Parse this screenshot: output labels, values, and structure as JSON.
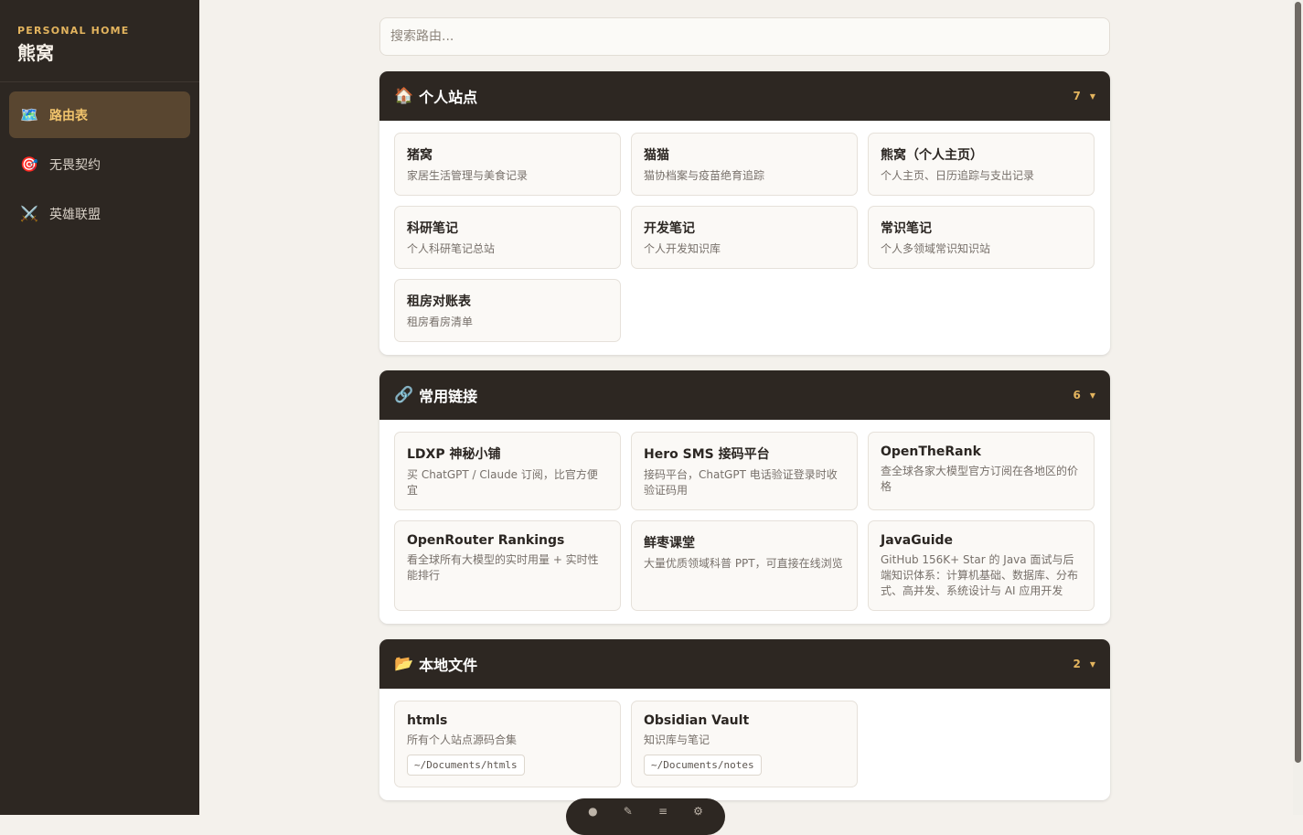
{
  "sidebar": {
    "brand_sub": "PERSONAL HOME",
    "brand_title": "熊窝",
    "items": [
      {
        "icon": "🗺️",
        "label": "路由表",
        "active": true
      },
      {
        "icon": "🎯",
        "label": "无畏契约"
      },
      {
        "icon": "⚔️",
        "label": "英雄联盟"
      }
    ]
  },
  "search": {
    "placeholder": "搜索路由..."
  },
  "sections": [
    {
      "icon": "🏠",
      "title": "个人站点",
      "count": "7",
      "caret": "▼",
      "cards": [
        {
          "title": "猪窝",
          "desc": "家居生活管理与美食记录"
        },
        {
          "title": "猫猫",
          "desc": "猫协档案与疫苗绝育追踪"
        },
        {
          "title": "熊窝（个人主页）",
          "desc": "个人主页、日历追踪与支出记录"
        },
        {
          "title": "科研笔记",
          "desc": "个人科研笔记总站"
        },
        {
          "title": "开发笔记",
          "desc": "个人开发知识库"
        },
        {
          "title": "常识笔记",
          "desc": "个人多领域常识知识站"
        },
        {
          "title": "租房对账表",
          "desc": "租房看房清单"
        }
      ]
    },
    {
      "icon": "🔗",
      "title": "常用链接",
      "count": "6",
      "caret": "▼",
      "cards": [
        {
          "title": "LDXP 神秘小铺",
          "desc": "买 ChatGPT / Claude 订阅，比官方便宜"
        },
        {
          "title": "Hero SMS 接码平台",
          "desc": "接码平台，ChatGPT 电话验证登录时收验证码用"
        },
        {
          "title": "OpenTheRank",
          "desc": "查全球各家大模型官方订阅在各地区的价格"
        },
        {
          "title": "OpenRouter Rankings",
          "desc": "看全球所有大模型的实时用量 + 实时性能排行"
        },
        {
          "title": "鲜枣课堂",
          "desc": "大量优质领域科普 PPT，可直接在线浏览"
        },
        {
          "title": "JavaGuide",
          "desc": "GitHub 156K+ Star 的 Java 面试与后端知识体系：计算机基础、数据库、分布式、高并发、系统设计与 AI 应用开发"
        }
      ]
    },
    {
      "icon": "📂",
      "title": "本地文件",
      "count": "2",
      "caret": "▼",
      "cards": [
        {
          "title": "htmls",
          "desc": "所有个人站点源码合集",
          "path": "~/Documents/htmls"
        },
        {
          "title": "Obsidian Vault",
          "desc": "知识库与笔记",
          "path": "~/Documents/notes"
        }
      ]
    }
  ]
}
